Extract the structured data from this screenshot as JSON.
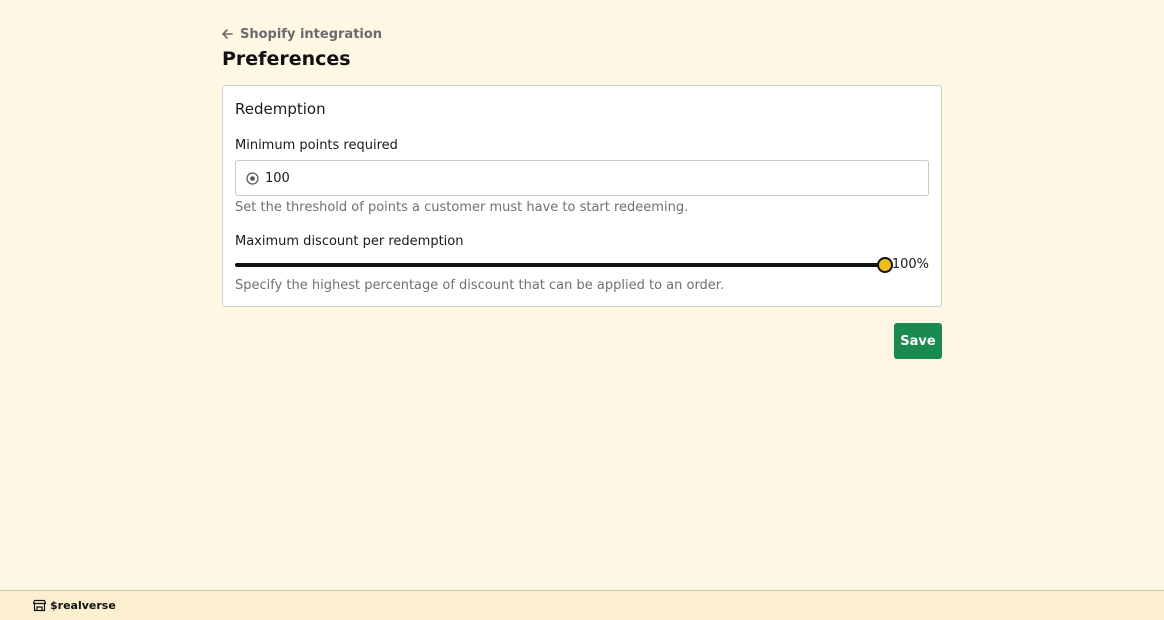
{
  "header": {
    "back_label": "Shopify integration",
    "title": "Preferences"
  },
  "redemption": {
    "section_title": "Redemption",
    "min_points": {
      "label": "Minimum points required",
      "value": "100",
      "help": "Set the threshold of points a customer must have to start redeeming."
    },
    "max_discount": {
      "label": "Maximum discount per redemption",
      "value_percent": 100,
      "value_label": "100%",
      "help": "Specify the highest percentage of discount that can be applied to an order."
    }
  },
  "actions": {
    "save_label": "Save"
  },
  "footer": {
    "brand": "$realverse"
  },
  "icons": {
    "back": "arrow-left-icon",
    "points": "radio-circle-icon",
    "brand": "storefront-icon"
  },
  "colors": {
    "background": "#fdf7e3",
    "primary": "#1b8a4f",
    "slider_thumb": "#f2bb1c",
    "footer_background": "#fdf0d0"
  }
}
